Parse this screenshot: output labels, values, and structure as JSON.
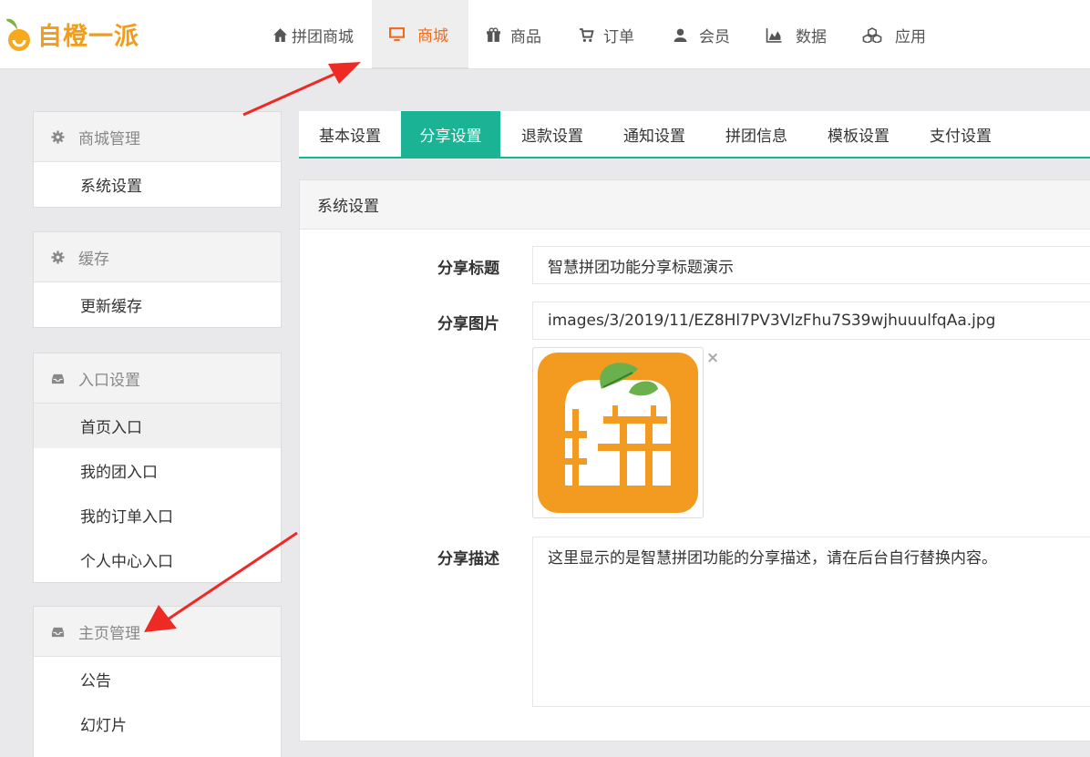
{
  "brand": {
    "name": "自橙一派",
    "color": "#f39c1a"
  },
  "accent": "#1ab394",
  "active_nav_color": "#f26b1d",
  "nav": [
    {
      "label": "拼团商城",
      "icon": "home-icon"
    },
    {
      "label": "商城",
      "icon": "monitor-icon"
    },
    {
      "label": "商品",
      "icon": "gift-icon"
    },
    {
      "label": "订单",
      "icon": "cart-icon"
    },
    {
      "label": "会员",
      "icon": "user-icon"
    },
    {
      "label": "数据",
      "icon": "area-chart-icon"
    },
    {
      "label": "应用",
      "icon": "cubes-icon"
    }
  ],
  "sidebar": [
    {
      "title": "商城管理",
      "icon": "gear-icon",
      "items": [
        "系统设置"
      ]
    },
    {
      "title": "缓存",
      "icon": "gear-icon",
      "items": [
        "更新缓存"
      ]
    },
    {
      "title": "入口设置",
      "icon": "inbox-icon",
      "items": [
        "首页入口",
        "我的团入口",
        "我的订单入口",
        "个人中心入口"
      ]
    },
    {
      "title": "主页管理",
      "icon": "inbox-icon",
      "items": [
        "公告",
        "幻灯片"
      ]
    }
  ],
  "tabs": [
    "基本设置",
    "分享设置",
    "退款设置",
    "通知设置",
    "拼团信息",
    "模板设置",
    "支付设置"
  ],
  "form": {
    "section_title": "系统设置",
    "share_title_label": "分享标题",
    "share_title_value": "智慧拼团功能分享标题演示",
    "share_image_label": "分享图片",
    "share_image_value": "images/3/2019/11/EZ8Hl7PV3VlzFhu7S39wjhuuulfqAa.jpg",
    "image_remove": "×",
    "share_desc_label": "分享描述",
    "share_desc_value": "这里显示的是智慧拼团功能的分享描述，请在后台自行替换内容。"
  }
}
